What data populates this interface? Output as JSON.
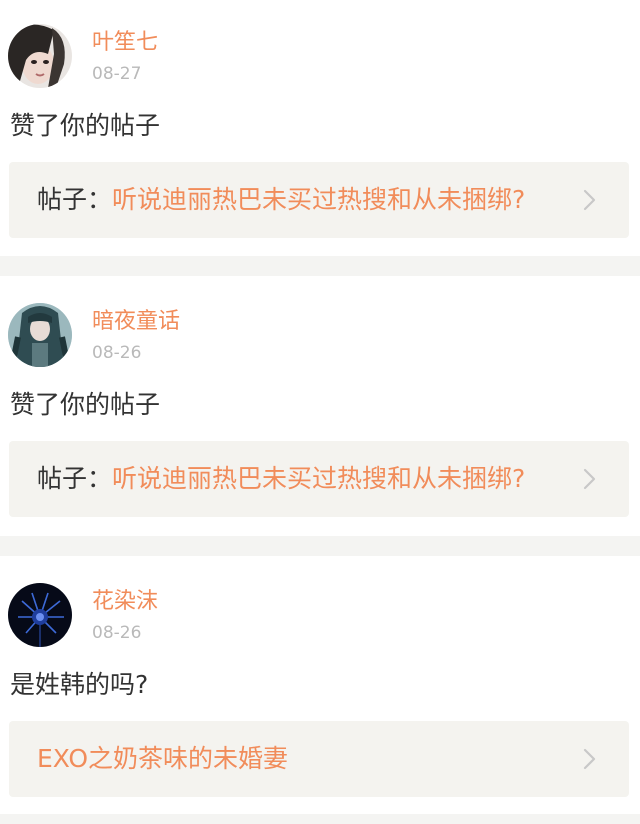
{
  "notifications": [
    {
      "username": "叶笙七",
      "date": "08-27",
      "message": "赞了你的帖子",
      "post_prefix": "帖子：",
      "post_title": "听说迪丽热巴未买过热搜和从未捆绑?",
      "avatar_color": "#d8d0cc"
    },
    {
      "username": "暗夜童话",
      "date": "08-26",
      "message": "赞了你的帖子",
      "post_prefix": "帖子：",
      "post_title": "听说迪丽热巴未买过热搜和从未捆绑?",
      "avatar_color": "#3f5d5c"
    },
    {
      "username": "花染沫",
      "date": "08-26",
      "message": "是姓韩的吗?",
      "post_prefix": "",
      "post_title": "EXO之奶茶味的未婚妻",
      "avatar_color": "#0d1530"
    }
  ],
  "colors": {
    "accent": "#f18c5a",
    "date": "#b9b9b9",
    "text": "#333333",
    "link_bg": "#f4f3ef",
    "separator": "#f4f4f2"
  },
  "icons": {
    "chevron": "chevron-right-icon"
  }
}
